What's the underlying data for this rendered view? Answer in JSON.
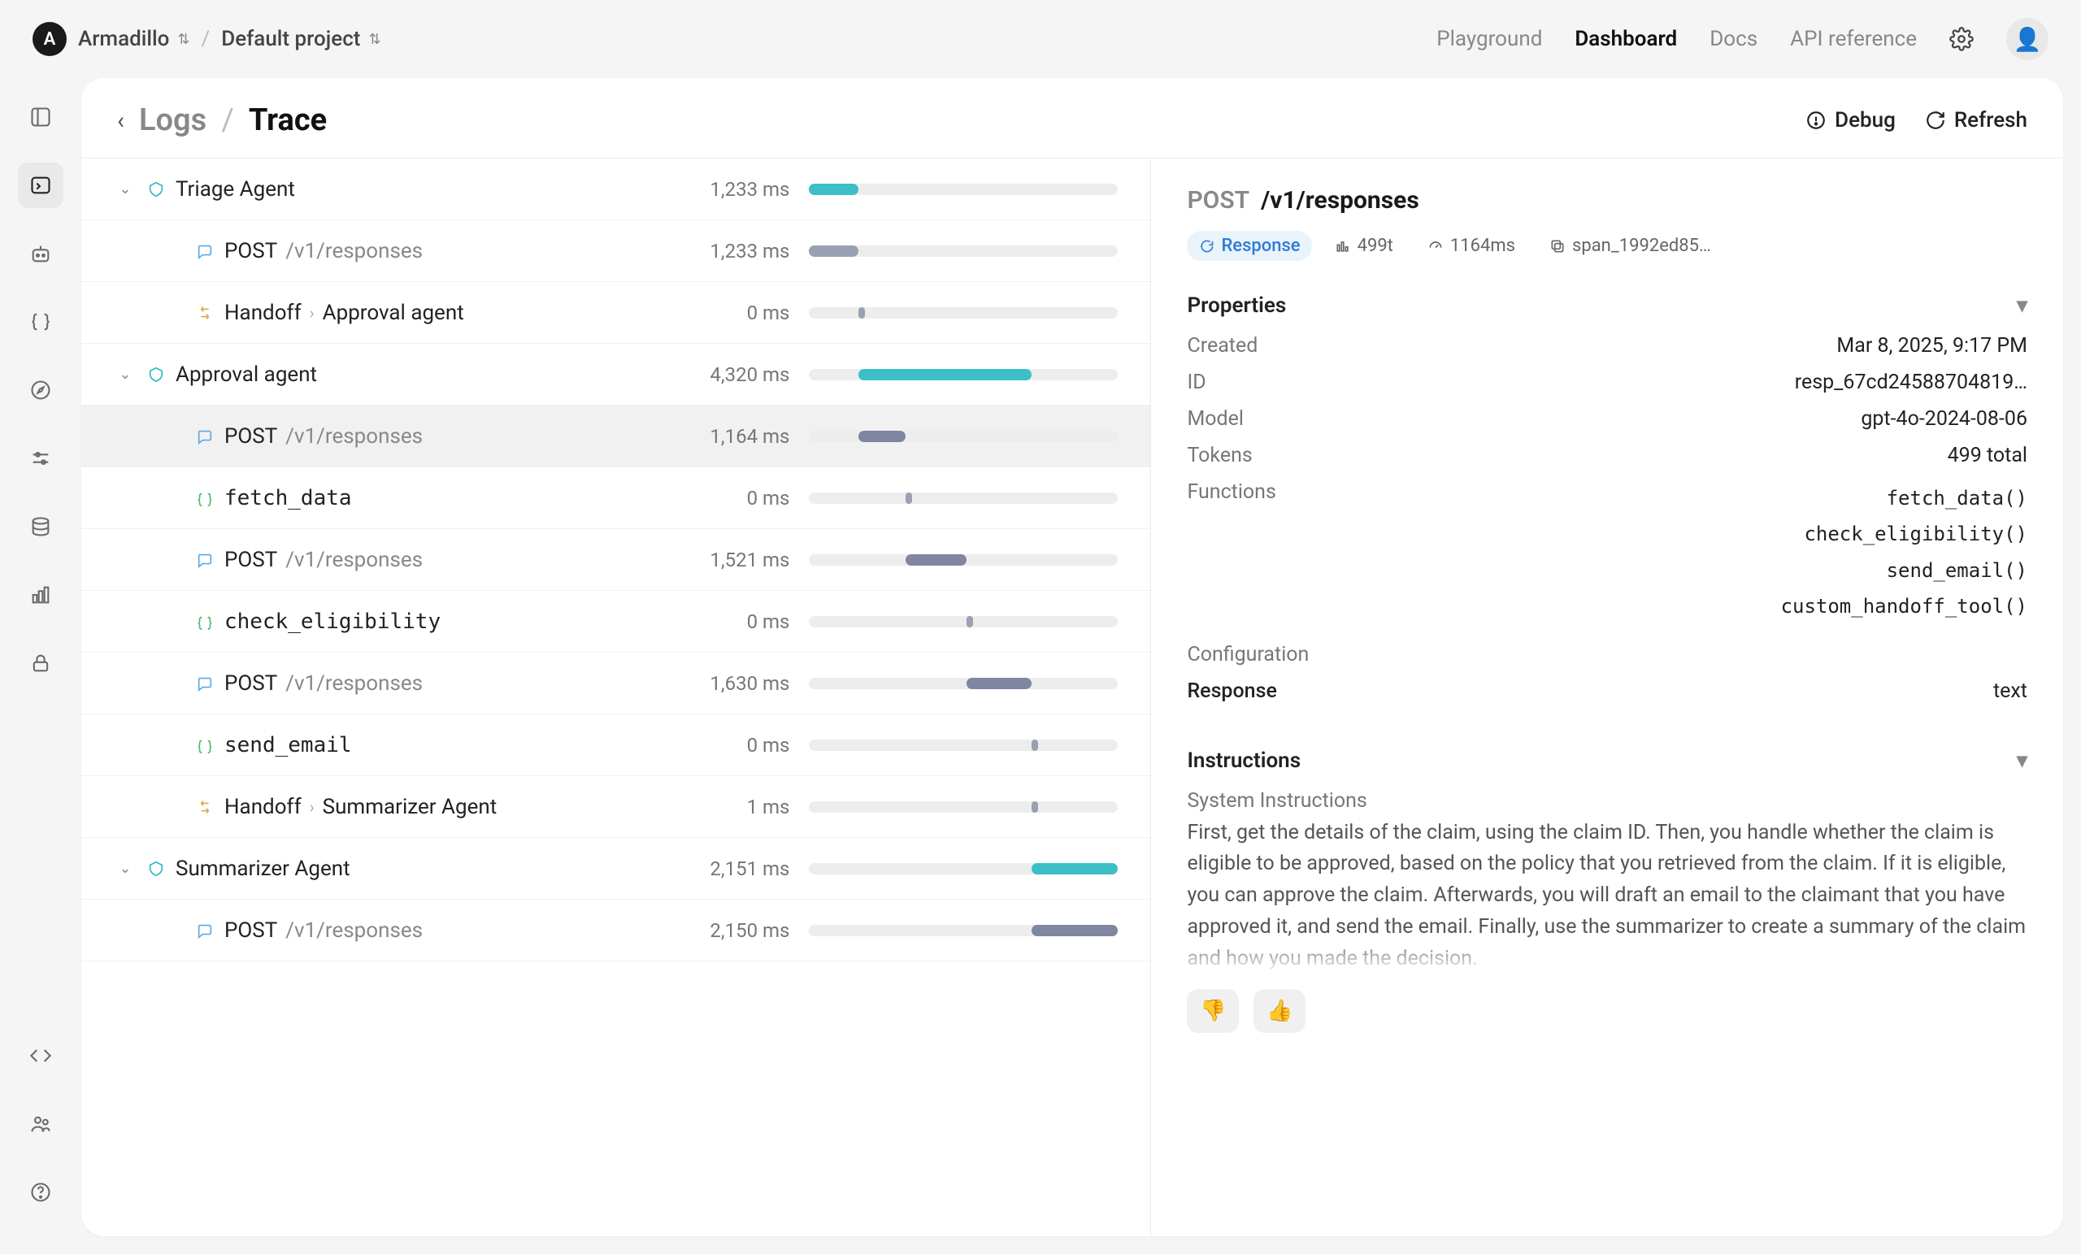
{
  "breadcrumb": {
    "orgInitial": "A",
    "org": "Armadillo",
    "project": "Default project"
  },
  "topnav": {
    "playground": "Playground",
    "dashboard": "Dashboard",
    "docs": "Docs",
    "api": "API reference"
  },
  "page": {
    "back": "Logs",
    "title": "Trace",
    "debug": "Debug",
    "refresh": "Refresh"
  },
  "totalMs": 7704,
  "trace": [
    {
      "id": 0,
      "depth": 0,
      "caret": true,
      "type": "agent",
      "label": "Triage Agent",
      "ms": "1,233 ms",
      "start": 0,
      "dur": 1233,
      "color": "#3cbfc6",
      "selected": false
    },
    {
      "id": 1,
      "depth": 1,
      "caret": false,
      "type": "post",
      "method": "POST",
      "path": "/v1/responses",
      "ms": "1,233 ms",
      "start": 0,
      "dur": 1233,
      "color": "#9aa0b4",
      "selected": false
    },
    {
      "id": 2,
      "depth": 1,
      "caret": false,
      "type": "handoff",
      "from": "Handoff",
      "to": "Approval agent",
      "ms": "0 ms",
      "start": 1233,
      "dur": 60,
      "color": "#9aa0b4",
      "selected": false
    },
    {
      "id": 3,
      "depth": 0,
      "caret": true,
      "type": "agent",
      "label": "Approval agent",
      "ms": "4,320 ms",
      "start": 1233,
      "dur": 4320,
      "color": "#3cbfc6",
      "selected": false
    },
    {
      "id": 4,
      "depth": 1,
      "caret": false,
      "type": "post",
      "method": "POST",
      "path": "/v1/responses",
      "ms": "1,164 ms",
      "start": 1233,
      "dur": 1164,
      "color": "#7e86a0",
      "selected": true
    },
    {
      "id": 5,
      "depth": 1,
      "caret": false,
      "type": "tool",
      "label": "fetch_data",
      "ms": "0 ms",
      "start": 2397,
      "dur": 60,
      "color": "#9aa0b4",
      "selected": false
    },
    {
      "id": 6,
      "depth": 1,
      "caret": false,
      "type": "post",
      "method": "POST",
      "path": "/v1/responses",
      "ms": "1,521 ms",
      "start": 2397,
      "dur": 1521,
      "color": "#7e86a0",
      "selected": false
    },
    {
      "id": 7,
      "depth": 1,
      "caret": false,
      "type": "tool",
      "label": "check_eligibility",
      "ms": "0 ms",
      "start": 3918,
      "dur": 60,
      "color": "#9aa0b4",
      "selected": false
    },
    {
      "id": 8,
      "depth": 1,
      "caret": false,
      "type": "post",
      "method": "POST",
      "path": "/v1/responses",
      "ms": "1,630 ms",
      "start": 3918,
      "dur": 1630,
      "color": "#7e86a0",
      "selected": false
    },
    {
      "id": 9,
      "depth": 1,
      "caret": false,
      "type": "tool",
      "label": "send_email",
      "ms": "0 ms",
      "start": 5548,
      "dur": 60,
      "color": "#9aa0b4",
      "selected": false
    },
    {
      "id": 10,
      "depth": 1,
      "caret": false,
      "type": "handoff",
      "from": "Handoff",
      "to": "Summarizer Agent",
      "ms": "1 ms",
      "start": 5548,
      "dur": 60,
      "color": "#9aa0b4",
      "selected": false
    },
    {
      "id": 11,
      "depth": 0,
      "caret": true,
      "type": "agent",
      "label": "Summarizer Agent",
      "ms": "2,151 ms",
      "start": 5553,
      "dur": 2151,
      "color": "#3cbfc6",
      "selected": false
    },
    {
      "id": 12,
      "depth": 1,
      "caret": false,
      "type": "post",
      "method": "POST",
      "path": "/v1/responses",
      "ms": "2,150 ms",
      "start": 5553,
      "dur": 2150,
      "color": "#7e86a0",
      "selected": false
    }
  ],
  "detail": {
    "method": "POST",
    "path": "/v1/responses",
    "chips": {
      "response": "Response",
      "tokens": "499t",
      "latency": "1164ms",
      "span": "span_1992ed85…"
    },
    "propsHeader": "Properties",
    "created_k": "Created",
    "created_v": "Mar 8, 2025, 9:17 PM",
    "id_k": "ID",
    "id_v": "resp_67cd24588704819…",
    "model_k": "Model",
    "model_v": "gpt-4o-2024-08-06",
    "tokens_k": "Tokens",
    "tokens_v": "499 total",
    "functions_k": "Functions",
    "functions": [
      "fetch_data()",
      "check_eligibility()",
      "send_email()",
      "custom_handoff_tool()"
    ],
    "config_k": "Configuration",
    "response_k": "Response",
    "response_v": "text",
    "instrHeader": "Instructions",
    "instrTitle": "System Instructions",
    "instrBody": "First, get the details of the claim, using the claim ID. Then, you handle whether the claim is eligible to be approved, based on the policy that you retrieved from the claim. If it is eligible, you can approve the claim. Afterwards, you will draft an email to the claimant that you have approved it, and send the email. Finally, use the summarizer to create a summary of the claim and how you made the decision."
  }
}
